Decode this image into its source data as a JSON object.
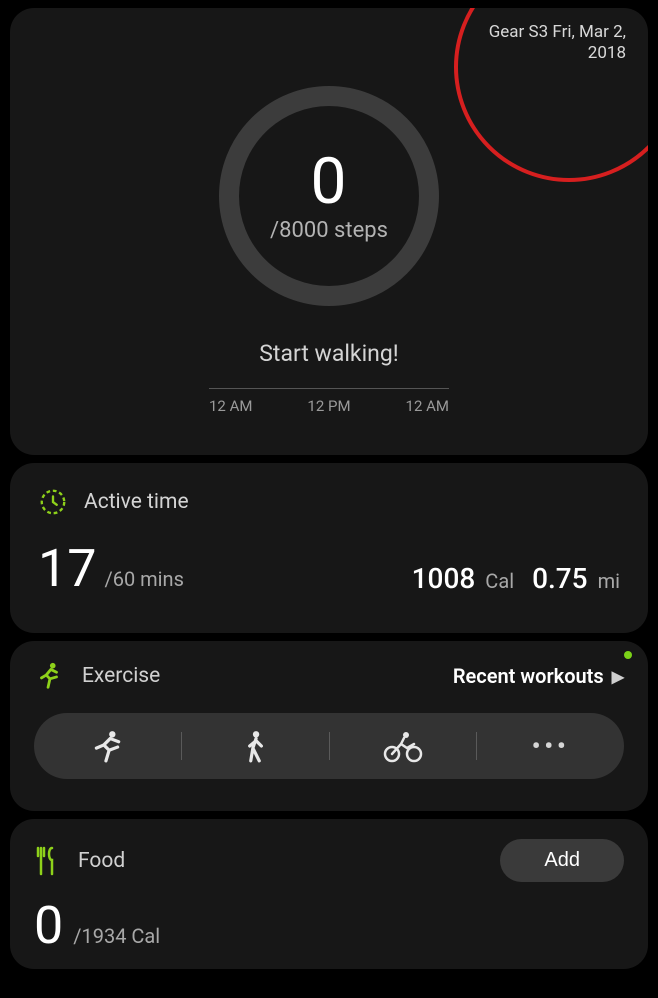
{
  "device": {
    "line1": "Gear S3 Fri, Mar 2,",
    "line2": "2018"
  },
  "steps": {
    "value": "0",
    "goal_text": "/8000 steps",
    "cta": "Start walking!",
    "timeline": {
      "t0": "12 AM",
      "t1": "12 PM",
      "t2": "12 AM"
    }
  },
  "active": {
    "title": "Active time",
    "value": "17",
    "goal_text": "/60 mins",
    "cal_value": "1008",
    "cal_unit": "Cal",
    "dist_value": "0.75",
    "dist_unit": "mi"
  },
  "exercise": {
    "title": "Exercise",
    "recent_label": "Recent workouts",
    "items": {
      "a": "running",
      "b": "walking",
      "c": "cycling",
      "d": "more"
    }
  },
  "food": {
    "title": "Food",
    "add_label": "Add",
    "value": "0",
    "goal_text": "/1934 Cal"
  },
  "colors": {
    "accent": "#8ed11a",
    "annotation": "#d61f1f"
  }
}
